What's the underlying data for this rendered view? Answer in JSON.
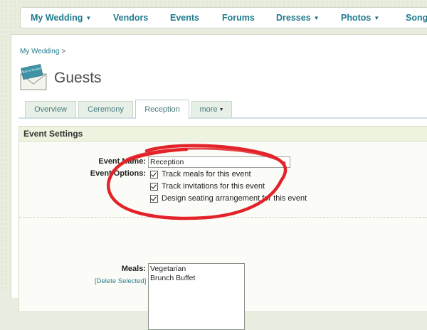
{
  "nav": {
    "items": [
      {
        "label": "My Wedding",
        "caret": true,
        "color": "#1f7a8c"
      },
      {
        "label": "Vendors",
        "caret": false
      },
      {
        "label": "Events",
        "caret": false
      },
      {
        "label": "Forums",
        "caret": false
      },
      {
        "label": "Dresses",
        "caret": true
      },
      {
        "label": "Photos",
        "caret": true
      },
      {
        "label": "Songs",
        "caret": false
      }
    ]
  },
  "breadcrumb": {
    "root": "My Wedding",
    "separator": ">"
  },
  "header": {
    "title": "Guests",
    "icon": "envelope-invite-icon"
  },
  "envelope_card_text": "You're Invited",
  "tabs": [
    {
      "label": "Overview",
      "active": false
    },
    {
      "label": "Ceremony",
      "active": false
    },
    {
      "label": "Reception",
      "active": true
    },
    {
      "label": "more",
      "caret": true,
      "active": false
    }
  ],
  "event_settings": {
    "heading": "Event Settings",
    "event_name_label": "Event Name:",
    "event_name_value": "Reception",
    "event_options_label": "Event Options:",
    "options": [
      {
        "label": "Track meals for this event",
        "checked": true
      },
      {
        "label": "Track invitations for this event",
        "checked": true
      },
      {
        "label": "Design seating arrangement for this event",
        "checked": true
      }
    ],
    "meals_label": "Meals:",
    "delete_selected": "[Delete Selected]",
    "meals": [
      "Vegetarian",
      "Brunch Buffet"
    ]
  },
  "colors": {
    "accent": "#1f7a8c",
    "annotation": "#e3232a",
    "background": "#e9eddf"
  }
}
